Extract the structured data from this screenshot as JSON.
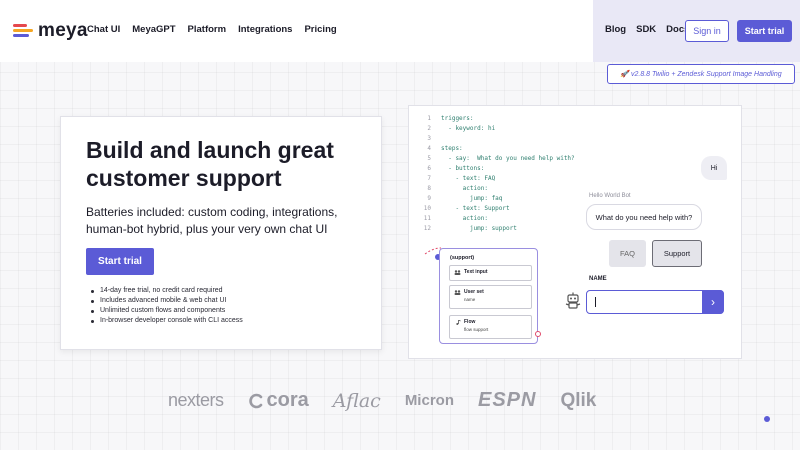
{
  "brand": {
    "name": "meya",
    "logo_colors": [
      "#e5484d",
      "#f5a623",
      "#5b5bd6"
    ]
  },
  "nav": {
    "items": [
      {
        "label": "Chat UI"
      },
      {
        "label": "MeyaGPT"
      },
      {
        "label": "Platform"
      },
      {
        "label": "Integrations"
      },
      {
        "label": "Pricing"
      }
    ],
    "right_links": [
      {
        "label": "Blog"
      },
      {
        "label": "SDK"
      },
      {
        "label": "Docs"
      }
    ],
    "signin_label": "Sign in",
    "start_trial_label": "Start trial"
  },
  "release_tag": "🚀 v2.8.8 Twilio + Zendesk Support Image Handling",
  "hero": {
    "title": "Build and launch great customer support",
    "subtitle": "Batteries included: custom coding, integrations, human-bot hybrid, plus your very own chat UI",
    "cta_label": "Start trial",
    "features": [
      "14-day free trial, no credit card required",
      "Includes advanced mobile & web chat UI",
      "Unlimited custom flows and components",
      "In-browser developer console with CLI access"
    ]
  },
  "demo": {
    "code_lines": [
      {
        "n": "1",
        "t": "triggers:"
      },
      {
        "n": "2",
        "t": "  - keyword: hi"
      },
      {
        "n": "3",
        "t": ""
      },
      {
        "n": "4",
        "t": "steps:"
      },
      {
        "n": "5",
        "t": "  - say:  What do you need help with?"
      },
      {
        "n": "6",
        "t": "  - buttons:"
      },
      {
        "n": "7",
        "t": "    - text: FAQ"
      },
      {
        "n": "8",
        "t": "      action:"
      },
      {
        "n": "9",
        "t": "        jump: faq"
      },
      {
        "n": "10",
        "t": "    - text: Support"
      },
      {
        "n": "11",
        "t": "      action:"
      },
      {
        "n": "12",
        "t": "        jump: support"
      }
    ],
    "chat": {
      "user_message": "Hi",
      "bot_name": "Hello World Bot",
      "bot_message": "What do you need help with?",
      "options": [
        "FAQ",
        "Support"
      ],
      "input_label": "NAME",
      "input_value": ""
    },
    "flow": {
      "title": "(support)",
      "nodes": [
        {
          "title": "Text input",
          "sub": "",
          "icon": "people-icon"
        },
        {
          "title": "User set",
          "sub": "name",
          "icon": "people-icon"
        },
        {
          "title": "Flow",
          "sub": "flow support",
          "icon": "music-note-icon"
        }
      ]
    }
  },
  "brands": [
    "nexters",
    "cora",
    "Aflac",
    "Micron",
    "ESPN",
    "Qlik"
  ],
  "colors": {
    "accent": "#5b5bd6",
    "header_right_bg": "#e9e8f6"
  }
}
